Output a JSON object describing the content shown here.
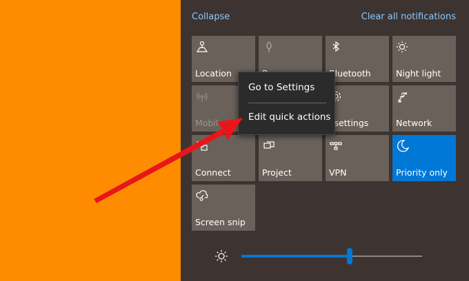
{
  "header": {
    "collapse": "Collapse",
    "clear_all": "Clear all notifications"
  },
  "tiles": [
    {
      "label": "Location",
      "icon": "location-icon"
    },
    {
      "label": "B",
      "icon": "battery-saver-icon"
    },
    {
      "label": "Bluetooth",
      "icon": "bluetooth-icon"
    },
    {
      "label": "Night light",
      "icon": "night-light-icon"
    },
    {
      "label": "Mobile",
      "icon": "mobile-hotspot-icon"
    },
    {
      "label": "l settings",
      "icon": "settings-icon"
    },
    {
      "label": "Network",
      "icon": "network-icon"
    },
    {
      "label": "Connect",
      "icon": "connect-icon"
    },
    {
      "label": "Project",
      "icon": "project-icon"
    },
    {
      "label": "VPN",
      "icon": "vpn-icon"
    },
    {
      "label": "Priority only",
      "icon": "moon-icon"
    },
    {
      "label": "Screen snip",
      "icon": "screen-snip-icon"
    }
  ],
  "context_menu": {
    "item1": "Go to Settings",
    "item2": "Edit quick actions"
  },
  "brightness": {
    "value": 0.6,
    "icon": "brightness-icon"
  },
  "colors": {
    "accent": "#0078d7",
    "tile": "#6a615b",
    "panel": "#3d3431",
    "background": "#ff8c00",
    "arrow": "#e8161b"
  }
}
